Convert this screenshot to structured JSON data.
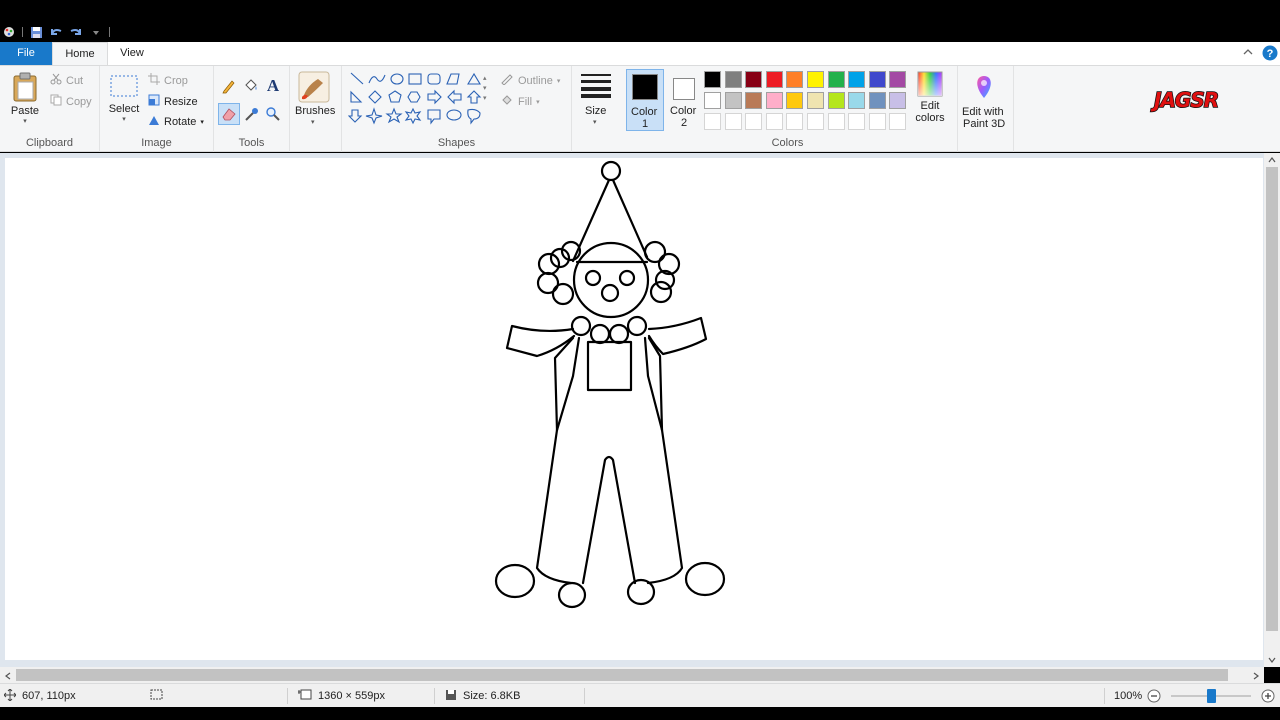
{
  "quick_access": {
    "icons": [
      "paint-app-icon",
      "save-icon",
      "undo-icon",
      "redo-icon",
      "customize-icon"
    ]
  },
  "tabs": [
    {
      "label": "File"
    },
    {
      "label": "Home"
    },
    {
      "label": "View"
    }
  ],
  "ribbon": {
    "clipboard": {
      "label": "Clipboard",
      "paste": "Paste",
      "cut": "Cut",
      "copy": "Copy"
    },
    "image": {
      "label": "Image",
      "select": "Select",
      "crop": "Crop",
      "resize": "Resize",
      "rotate": "Rotate"
    },
    "tools": {
      "label": "Tools"
    },
    "brushes": {
      "label": "Brushes"
    },
    "shapes": {
      "label": "Shapes",
      "outline": "Outline",
      "fill": "Fill"
    },
    "size": {
      "label": "Size"
    },
    "colors": {
      "label": "Colors",
      "color1_label": "Color",
      "color1_num": "1",
      "color2_label": "Color",
      "color2_num": "2",
      "color1_value": "#000000",
      "color2_value": "#ffffff",
      "palette_row1": [
        "#000000",
        "#7f7f7f",
        "#880015",
        "#ed1c24",
        "#ff7f27",
        "#fff200",
        "#22b14c",
        "#00a2e8",
        "#3f48cc",
        "#a349a4"
      ],
      "palette_row2": [
        "#ffffff",
        "#c3c3c3",
        "#b97a57",
        "#ffaec9",
        "#ffc90e",
        "#efe4b0",
        "#b5e61d",
        "#99d9ea",
        "#7092be",
        "#c8bfe7"
      ],
      "edit_colors_line1": "Edit",
      "edit_colors_line2": "colors"
    },
    "paint3d": {
      "line1": "Edit with",
      "line2": "Paint 3D"
    },
    "watermark": "JAGSR"
  },
  "status": {
    "cursor_pos": "607, 110px",
    "canvas_size": "1360 × 559px",
    "file_size": "Size: 6.8KB",
    "zoom": "100%"
  }
}
